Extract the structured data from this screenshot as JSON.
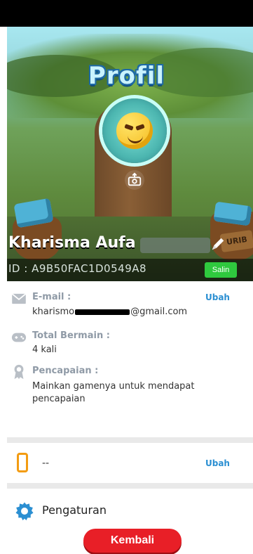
{
  "header": {
    "title": "Profil",
    "name": "Kharisma Aufa",
    "id_text": "ID : A9B50FAC1D0549A8",
    "copy_label": "Salin"
  },
  "email": {
    "label": "E-mail :",
    "value_prefix": "kharismo",
    "value_suffix": "@gmail.com",
    "action": "Ubah"
  },
  "plays": {
    "label": "Total Bermain :",
    "value": "4 kali"
  },
  "achievement": {
    "label": "Pencapaian :",
    "value": "Mainkan gamenya untuk mendapat pencapaian"
  },
  "phone": {
    "value": "--",
    "action": "Ubah"
  },
  "settings": {
    "label": "Pengaturan"
  },
  "footer": {
    "back_label": "Kembali"
  },
  "scene": {
    "sign_text": "URIB"
  },
  "colors": {
    "salin": "#2fc93e",
    "ubah": "#2b8fd2",
    "kembali": "#e81f27",
    "phone_icon": "#f39c12",
    "settings_icon": "#2b8fd2"
  }
}
